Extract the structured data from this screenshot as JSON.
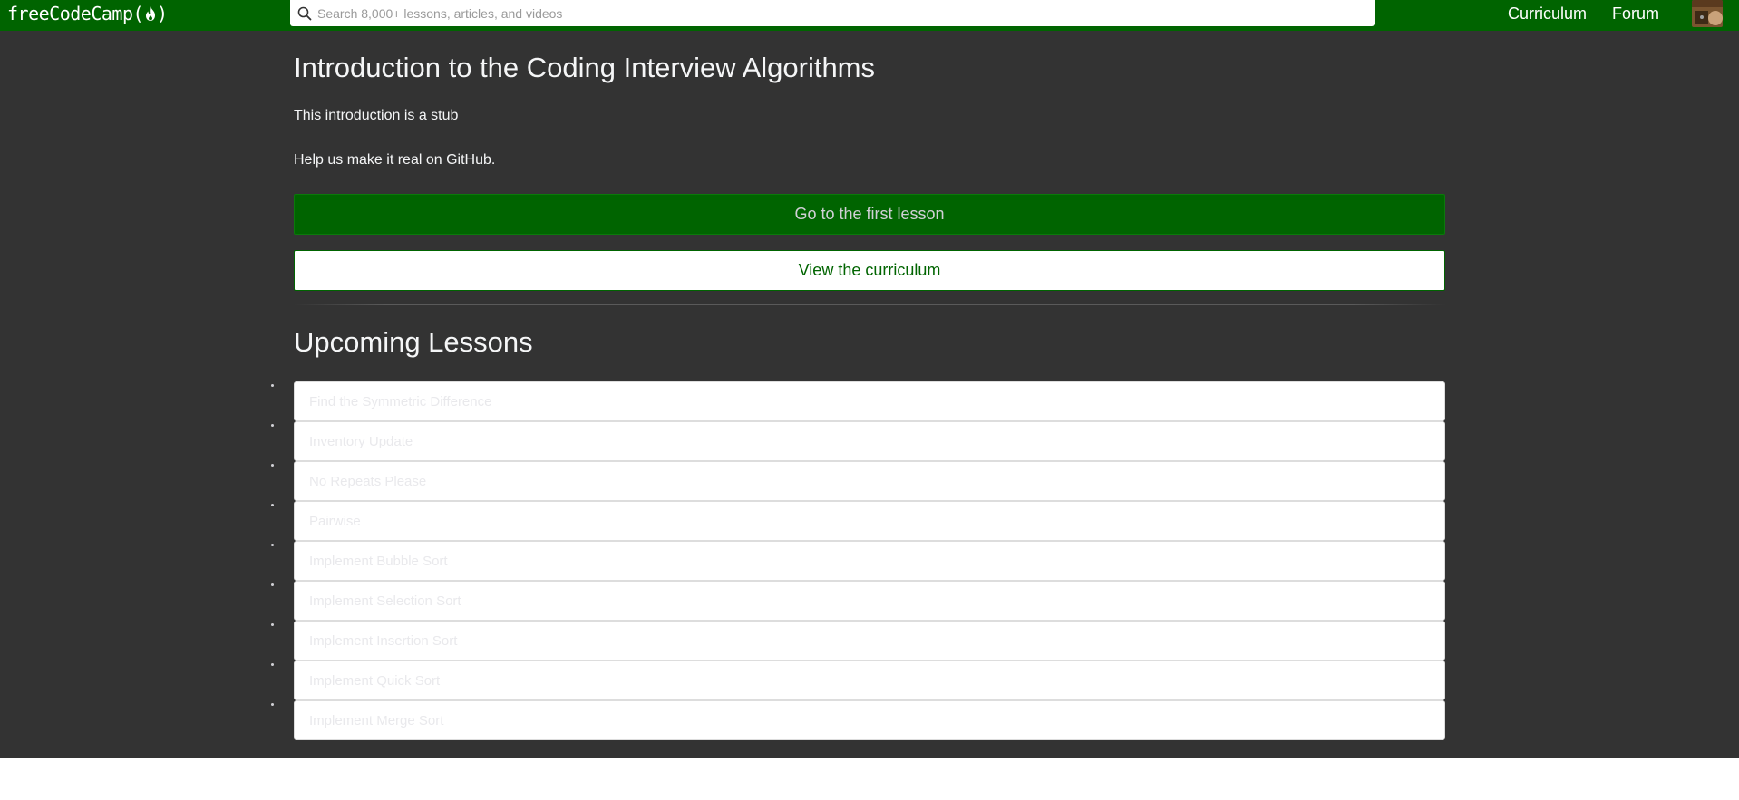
{
  "navbar": {
    "brand_text": "freeCodeCamp(",
    "brand_close": ")",
    "search_placeholder": "Search 8,000+ lessons, articles, and videos",
    "links": [
      {
        "label": "Curriculum"
      },
      {
        "label": "Forum"
      }
    ]
  },
  "main": {
    "title": "Introduction to the Coding Interview Algorithms",
    "intro_text": "This introduction is a stub",
    "help_text": "Help us make it real on GitHub.",
    "primary_button": "Go to the first lesson",
    "secondary_button": "View the curriculum",
    "upcoming_title": "Upcoming Lessons",
    "lessons": [
      {
        "title": "Find the Symmetric Difference"
      },
      {
        "title": "Inventory Update"
      },
      {
        "title": "No Repeats Please"
      },
      {
        "title": "Pairwise"
      },
      {
        "title": "Implement Bubble Sort"
      },
      {
        "title": "Implement Selection Sort"
      },
      {
        "title": "Implement Insertion Sort"
      },
      {
        "title": "Implement Quick Sort"
      },
      {
        "title": "Implement Merge Sort"
      }
    ]
  },
  "colors": {
    "brand_green": "#006400",
    "page_background": "#333333",
    "text_light": "#f5f6f7"
  },
  "icons": {
    "search": "search-icon",
    "flame": "flame-icon",
    "avatar": "avatar-image"
  }
}
